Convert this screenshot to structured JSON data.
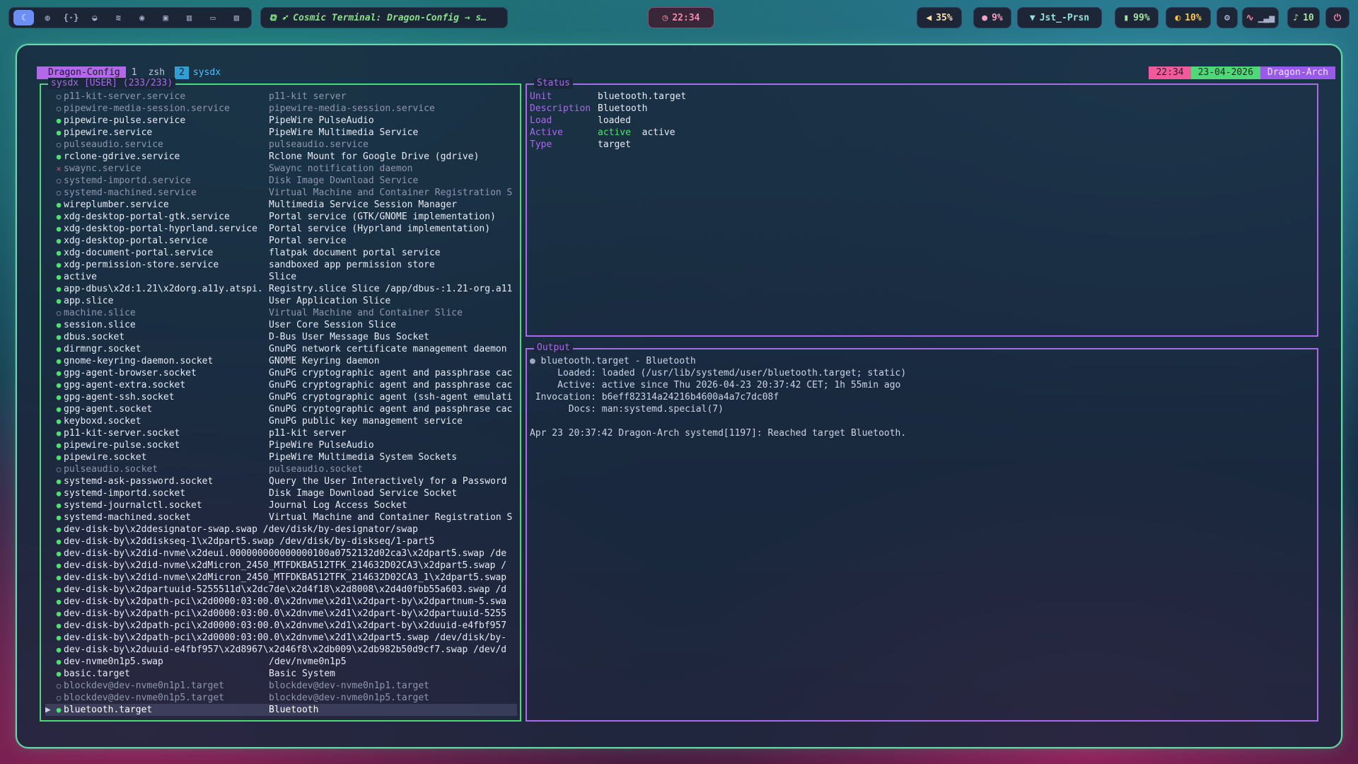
{
  "topbar": {
    "workspaces": [
      {
        "icon": "moon-icon",
        "glyph": "☾",
        "active": true
      },
      {
        "icon": "globe-icon",
        "glyph": "◍",
        "active": false
      },
      {
        "icon": "code-icon",
        "glyph": "{·}",
        "active": false
      },
      {
        "icon": "compass-icon",
        "glyph": "◒",
        "active": false
      },
      {
        "icon": "layers-icon",
        "glyph": "≋",
        "active": false
      },
      {
        "icon": "discord-icon",
        "glyph": "◉",
        "active": false
      },
      {
        "icon": "note-icon",
        "glyph": "▣",
        "active": false
      },
      {
        "icon": "chart-icon",
        "glyph": "▥",
        "active": false
      },
      {
        "icon": "gamepad-icon",
        "glyph": "▭",
        "active": false
      },
      {
        "icon": "tools-icon",
        "glyph": "▧",
        "active": false
      }
    ],
    "window_title": "Cosmic Terminal: Dragon-Config → s…",
    "clock": "22:34",
    "volume": "35%",
    "memory": "9%",
    "network": "Jst_-Prsn",
    "battery": "99%",
    "cpu": "10%",
    "notifications": "10"
  },
  "tabs": {
    "session": "Dragon-Config",
    "tab1_num": "1",
    "tab1_name": "zsh",
    "tab2_num": "2",
    "tab2_name": "sysdx"
  },
  "statusline": {
    "time": "22:34",
    "date": "23-04-2026",
    "host": "Dragon-Arch"
  },
  "units_panel": {
    "title": "sysdx [USER] (233/233)",
    "units": [
      {
        "name": "p11-kit-server.service",
        "desc": "p11-kit server",
        "state": "inactive"
      },
      {
        "name": "pipewire-media-session.service",
        "desc": "pipewire-media-session.service",
        "state": "inactive"
      },
      {
        "name": "pipewire-pulse.service",
        "desc": "PipeWire PulseAudio",
        "state": "active"
      },
      {
        "name": "pipewire.service",
        "desc": "PipeWire Multimedia Service",
        "state": "active"
      },
      {
        "name": "pulseaudio.service",
        "desc": "pulseaudio.service",
        "state": "inactive"
      },
      {
        "name": "rclone-gdrive.service",
        "desc": "Rclone Mount for Google Drive (gdrive)",
        "state": "active"
      },
      {
        "name": "swaync.service",
        "desc": "Swaync notification daemon",
        "state": "failed"
      },
      {
        "name": "systemd-importd.service",
        "desc": "Disk Image Download Service",
        "state": "inactive"
      },
      {
        "name": "systemd-machined.service",
        "desc": "Virtual Machine and Container Registration S",
        "state": "inactive"
      },
      {
        "name": "wireplumber.service",
        "desc": "Multimedia Service Session Manager",
        "state": "active"
      },
      {
        "name": "xdg-desktop-portal-gtk.service",
        "desc": "Portal service (GTK/GNOME implementation)",
        "state": "active"
      },
      {
        "name": "xdg-desktop-portal-hyprland.service",
        "desc": "Portal service (Hyprland implementation)",
        "state": "active"
      },
      {
        "name": "xdg-desktop-portal.service",
        "desc": "Portal service",
        "state": "active"
      },
      {
        "name": "xdg-document-portal.service",
        "desc": "flatpak document portal service",
        "state": "active"
      },
      {
        "name": "xdg-permission-store.service",
        "desc": "sandboxed app permission store",
        "state": "active"
      },
      {
        "name": "active",
        "desc": "Slice",
        "state": "active"
      },
      {
        "name": "app-dbus\\x2d:1.21\\x2dorg.a11y.atspi.",
        "desc": "Registry.slice Slice /app/dbus-:1.21-org.a11",
        "state": "active"
      },
      {
        "name": "app.slice",
        "desc": "User Application Slice",
        "state": "active"
      },
      {
        "name": "machine.slice",
        "desc": "Virtual Machine and Container Slice",
        "state": "inactive"
      },
      {
        "name": "session.slice",
        "desc": "User Core Session Slice",
        "state": "active"
      },
      {
        "name": "dbus.socket",
        "desc": "D-Bus User Message Bus Socket",
        "state": "active"
      },
      {
        "name": "dirmngr.socket",
        "desc": "GnuPG network certificate management daemon",
        "state": "active"
      },
      {
        "name": "gnome-keyring-daemon.socket",
        "desc": "GNOME Keyring daemon",
        "state": "active"
      },
      {
        "name": "gpg-agent-browser.socket",
        "desc": "GnuPG cryptographic agent and passphrase cac",
        "state": "active"
      },
      {
        "name": "gpg-agent-extra.socket",
        "desc": "GnuPG cryptographic agent and passphrase cac",
        "state": "active"
      },
      {
        "name": "gpg-agent-ssh.socket",
        "desc": "GnuPG cryptographic agent (ssh-agent emulati",
        "state": "active"
      },
      {
        "name": "gpg-agent.socket",
        "desc": "GnuPG cryptographic agent and passphrase cac",
        "state": "active"
      },
      {
        "name": "keyboxd.socket",
        "desc": "GnuPG public key management service",
        "state": "active"
      },
      {
        "name": "p11-kit-server.socket",
        "desc": "p11-kit server",
        "state": "active"
      },
      {
        "name": "pipewire-pulse.socket",
        "desc": "PipeWire PulseAudio",
        "state": "active"
      },
      {
        "name": "pipewire.socket",
        "desc": "PipeWire Multimedia System Sockets",
        "state": "active"
      },
      {
        "name": "pulseaudio.socket",
        "desc": "pulseaudio.socket",
        "state": "inactive"
      },
      {
        "name": "systemd-ask-password.socket",
        "desc": "Query the User Interactively for a Password",
        "state": "active"
      },
      {
        "name": "systemd-importd.socket",
        "desc": "Disk Image Download Service Socket",
        "state": "active"
      },
      {
        "name": "systemd-journalctl.socket",
        "desc": "Journal Log Access Socket",
        "state": "active"
      },
      {
        "name": "systemd-machined.socket",
        "desc": "Virtual Machine and Container Registration S",
        "state": "active"
      },
      {
        "name": "dev-disk-by\\x2ddesignator-swap.swap /dev/disk/by-designator/swap",
        "desc": "",
        "state": "active",
        "long": true
      },
      {
        "name": "dev-disk-by\\x2ddiskseq-1\\x2dpart5.swap /dev/disk/by-diskseq/1-part5",
        "desc": "",
        "state": "active",
        "long": true
      },
      {
        "name": "dev-disk-by\\x2did-nvme\\x2deui.000000000000000100a0752132d02ca3\\x2dpart5.swap /de",
        "desc": "",
        "state": "active",
        "long": true
      },
      {
        "name": "dev-disk-by\\x2did-nvme\\x2dMicron_2450_MTFDKBA512TFK_214632D02CA3\\x2dpart5.swap /",
        "desc": "",
        "state": "active",
        "long": true
      },
      {
        "name": "dev-disk-by\\x2did-nvme\\x2dMicron_2450_MTFDKBA512TFK_214632D02CA3_1\\x2dpart5.swap",
        "desc": "",
        "state": "active",
        "long": true
      },
      {
        "name": "dev-disk-by\\x2dpartuuid-5255511d\\x2dc7de\\x2d4f18\\x2d8008\\x2d4d0fbb55a603.swap /d",
        "desc": "",
        "state": "active",
        "long": true
      },
      {
        "name": "dev-disk-by\\x2dpath-pci\\x2d0000:03:00.0\\x2dnvme\\x2d1\\x2dpart-by\\x2dpartnum-5.swa",
        "desc": "",
        "state": "active",
        "long": true
      },
      {
        "name": "dev-disk-by\\x2dpath-pci\\x2d0000:03:00.0\\x2dnvme\\x2d1\\x2dpart-by\\x2dpartuuid-5255",
        "desc": "",
        "state": "active",
        "long": true
      },
      {
        "name": "dev-disk-by\\x2dpath-pci\\x2d0000:03:00.0\\x2dnvme\\x2d1\\x2dpart-by\\x2duuid-e4fbf957",
        "desc": "",
        "state": "active",
        "long": true
      },
      {
        "name": "dev-disk-by\\x2dpath-pci\\x2d0000:03:00.0\\x2dnvme\\x2d1\\x2dpart5.swap /dev/disk/by-",
        "desc": "",
        "state": "active",
        "long": true
      },
      {
        "name": "dev-disk-by\\x2duuid-e4fbf957\\x2d8967\\x2d46f8\\x2db009\\x2db982b50d9cf7.swap /dev/d",
        "desc": "",
        "state": "active",
        "long": true
      },
      {
        "name": "dev-nvme0n1p5.swap",
        "desc": "/dev/nvme0n1p5",
        "state": "active"
      },
      {
        "name": "basic.target",
        "desc": "Basic System",
        "state": "active"
      },
      {
        "name": "blockdev@dev-nvme0n1p1.target",
        "desc": "blockdev@dev-nvme0n1p1.target",
        "state": "inactive"
      },
      {
        "name": "blockdev@dev-nvme0n1p5.target",
        "desc": "blockdev@dev-nvme0n1p5.target",
        "state": "inactive"
      },
      {
        "name": "bluetooth.target",
        "desc": "Bluetooth",
        "state": "active",
        "selected": true
      }
    ]
  },
  "status_panel": {
    "title": "Status",
    "unit_label": "Unit",
    "unit_value": "bluetooth.target",
    "desc_label": "Description",
    "desc_value": "Bluetooth",
    "load_label": "Load",
    "load_value": "loaded",
    "active_label": "Active",
    "active_value_1": "active",
    "active_value_2": "active",
    "type_label": "Type",
    "type_value": "target"
  },
  "output_panel": {
    "title": "Output",
    "bullet": "●",
    "lines": [
      "bluetooth.target - Bluetooth",
      "     Loaded: loaded (/usr/lib/systemd/user/bluetooth.target; static)",
      "     Active: active since Thu 2026-04-23 20:37:42 CET; 1h 55min ago",
      " Invocation: b6eff82314a24216b4600a4a7c7dc08f",
      "       Docs: man:systemd.special(7)",
      "",
      "Apr 23 20:37:42 Dragon-Arch systemd[1197]: Reached target Bluetooth."
    ]
  },
  "colors": {
    "active": "#50e070",
    "inactive": "#8e96ae",
    "failed": "#e05a7a",
    "left_border": "#50d878",
    "right_border": "#a86ae8"
  }
}
